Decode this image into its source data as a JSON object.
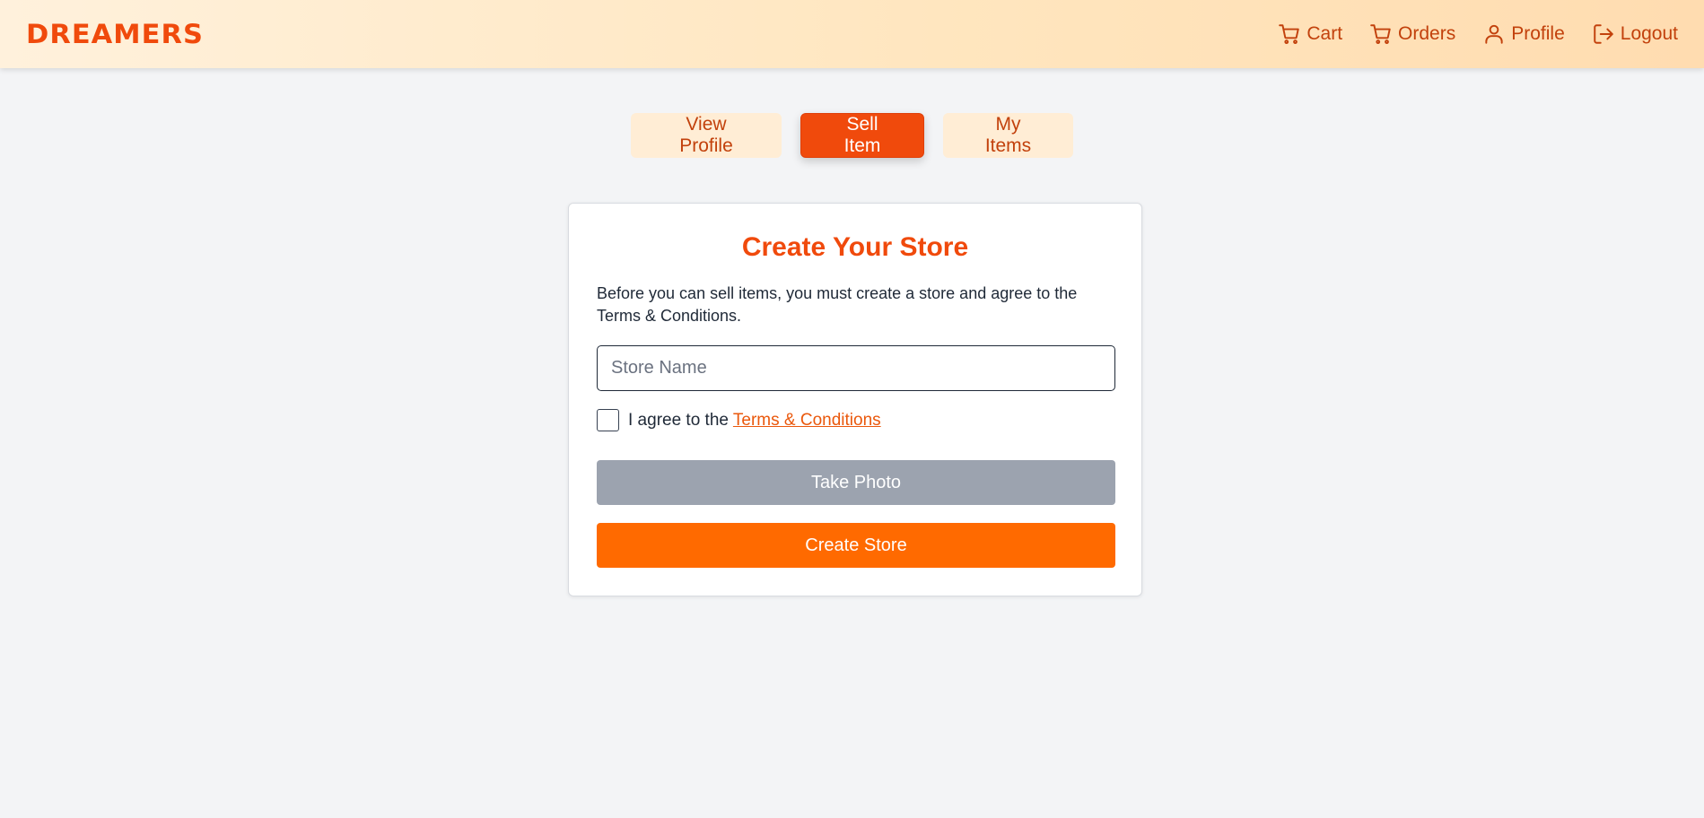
{
  "header": {
    "brand": "DREAMERS",
    "nav": [
      {
        "label": "Cart",
        "icon": "cart-icon"
      },
      {
        "label": "Orders",
        "icon": "cart-icon"
      },
      {
        "label": "Profile",
        "icon": "user-icon"
      },
      {
        "label": "Logout",
        "icon": "logout-icon"
      }
    ]
  },
  "tabs": {
    "view_profile": "View Profile",
    "sell_item": "Sell Item",
    "my_items": "My Items",
    "active": "Sell Item"
  },
  "store_form": {
    "title": "Create Your Store",
    "description": "Before you can sell items, you must create a store and agree to the Terms & Conditions.",
    "store_name": {
      "placeholder": "Store Name",
      "value": ""
    },
    "agree_prefix": "I agree to the ",
    "terms_link": "Terms & Conditions",
    "agreed": false,
    "take_photo_label": "Take Photo",
    "create_store_label": "Create Store"
  },
  "colors": {
    "brand": "#f04a0c",
    "nav_text": "#c2410c",
    "tab_inactive_bg": "#ffedd5",
    "create_button": "#ff6a00",
    "photo_button": "#9ca3af"
  }
}
